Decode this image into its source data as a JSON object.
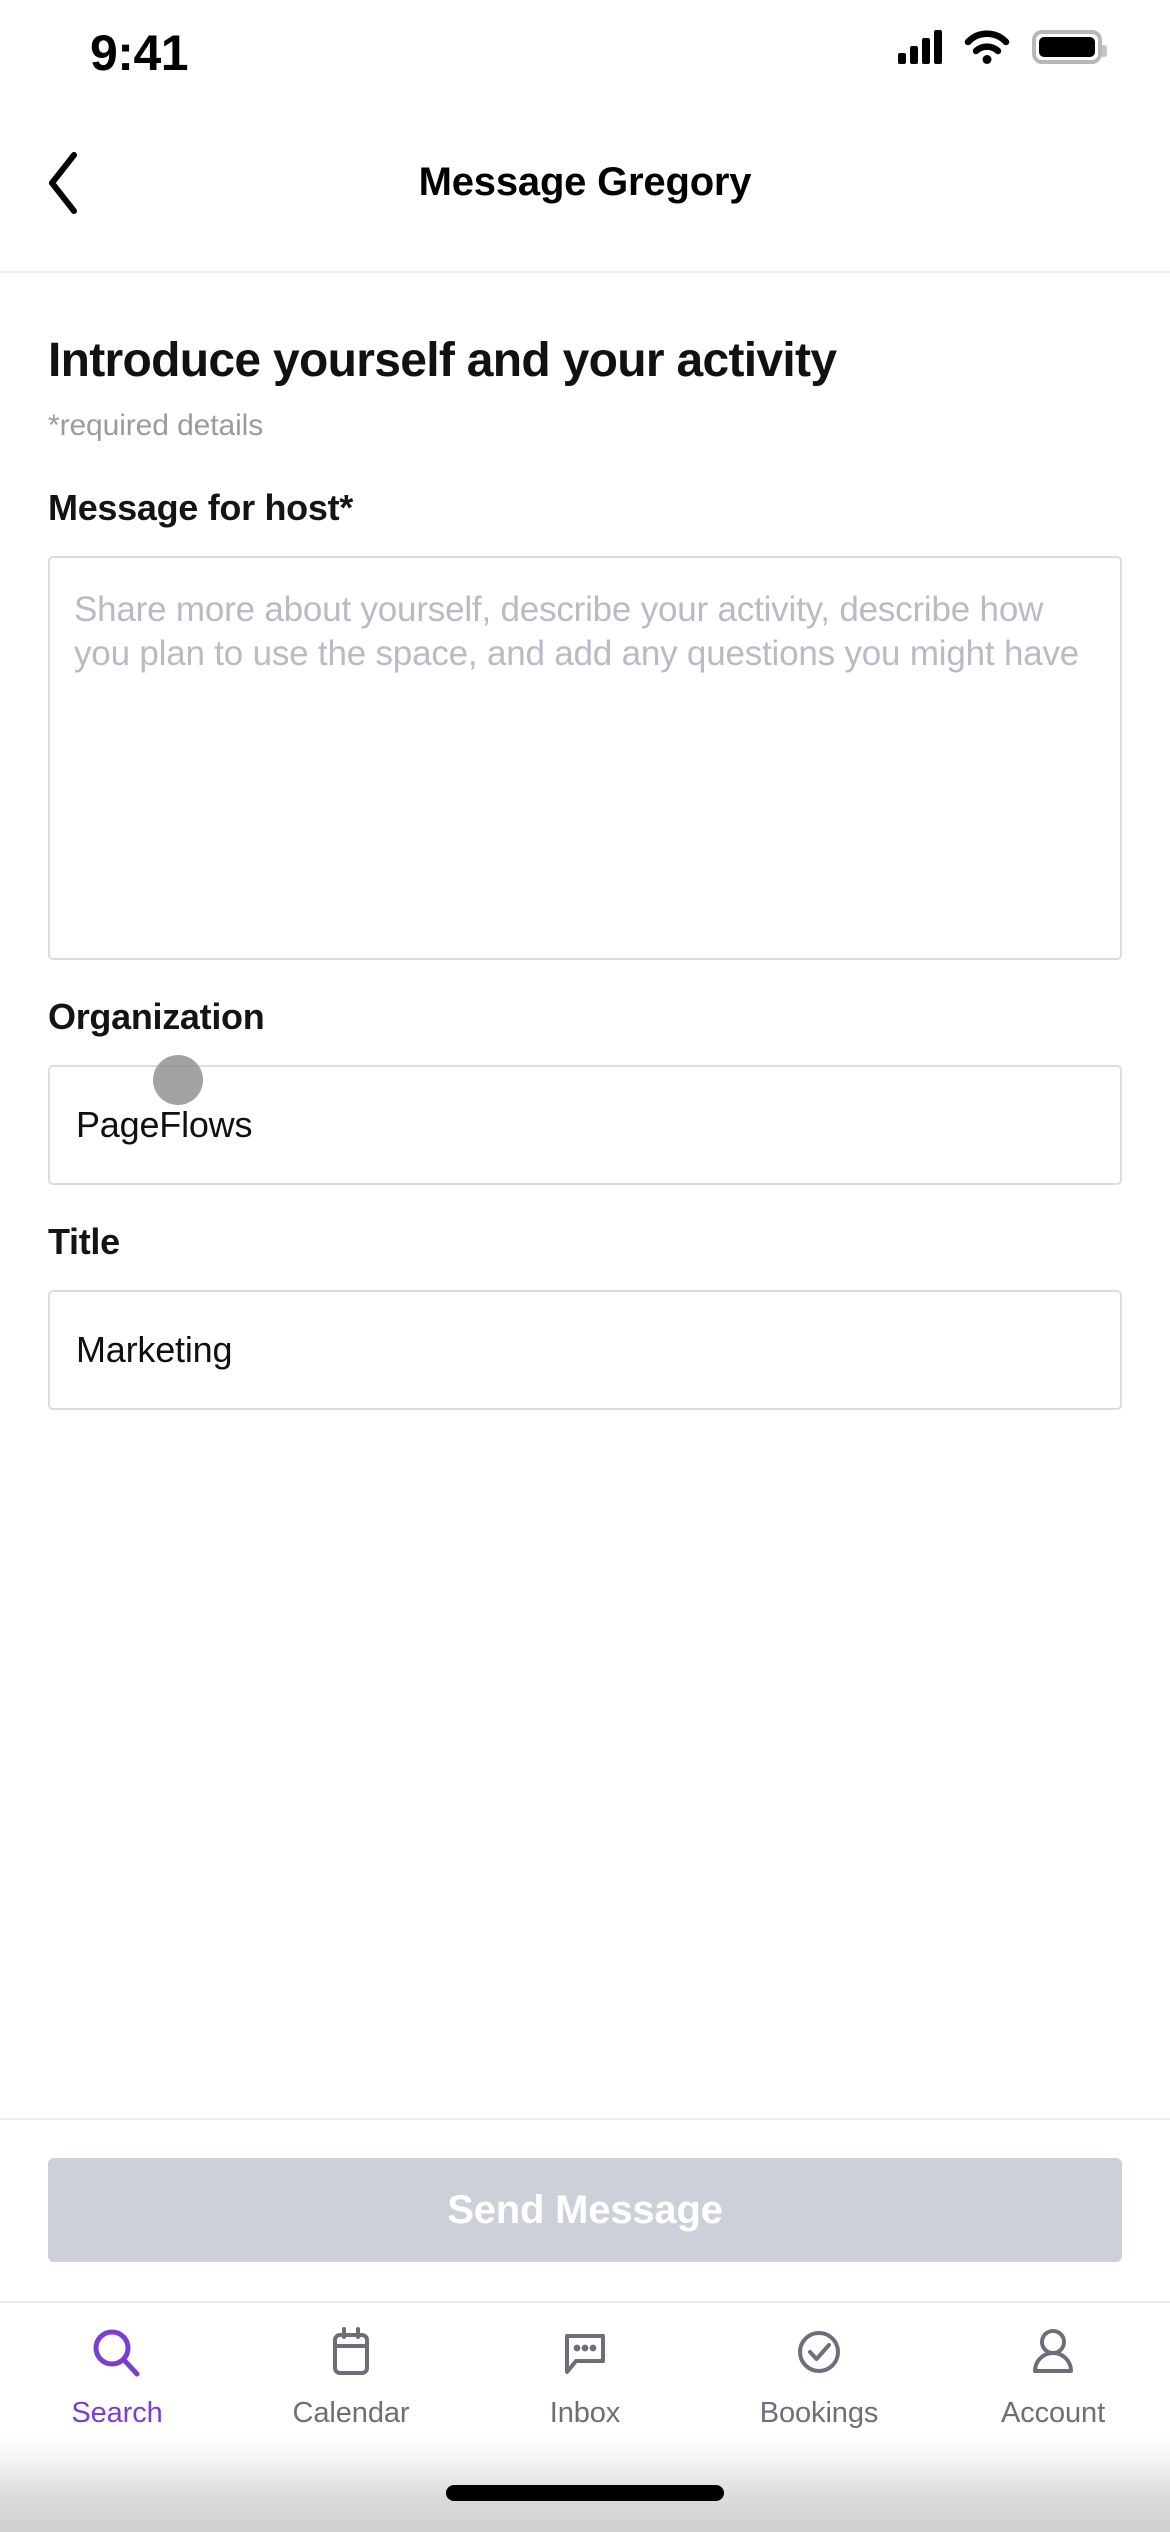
{
  "status_bar": {
    "time": "9:41",
    "signal_icon": "cellular-signal-icon",
    "wifi_icon": "wifi-icon",
    "battery_icon": "battery-full-icon"
  },
  "nav_bar": {
    "back_icon": "chevron-left-icon",
    "title": "Message Gregory"
  },
  "form": {
    "heading": "Introduce yourself and your activity",
    "required_note": "*required details",
    "fields": [
      {
        "label": "Message for host*",
        "type": "textarea",
        "value": "",
        "placeholder": "Share more about yourself, describe your activity, describe how you plan to use the space, and add any questions you might have"
      },
      {
        "label": "Organization",
        "type": "text",
        "value": "PageFlows",
        "placeholder": ""
      },
      {
        "label": "Title",
        "type": "text",
        "value": "Marketing",
        "placeholder": ""
      }
    ]
  },
  "footer": {
    "send_label": "Send Message",
    "send_disabled": true,
    "send_bg_color": "#ccd0d9",
    "send_text_color": "#ffffff"
  },
  "tab_bar": {
    "active_color": "#7b3fd0",
    "inactive_color": "#6c6e79",
    "items": [
      {
        "label": "Search",
        "icon": "search-icon",
        "active": true
      },
      {
        "label": "Calendar",
        "icon": "calendar-icon",
        "active": false
      },
      {
        "label": "Inbox",
        "icon": "chat-bubble-dots-icon",
        "active": false
      },
      {
        "label": "Bookings",
        "icon": "check-circle-icon",
        "active": false
      },
      {
        "label": "Account",
        "icon": "person-icon",
        "active": false
      }
    ]
  },
  "home_indicator": {
    "present": true
  }
}
